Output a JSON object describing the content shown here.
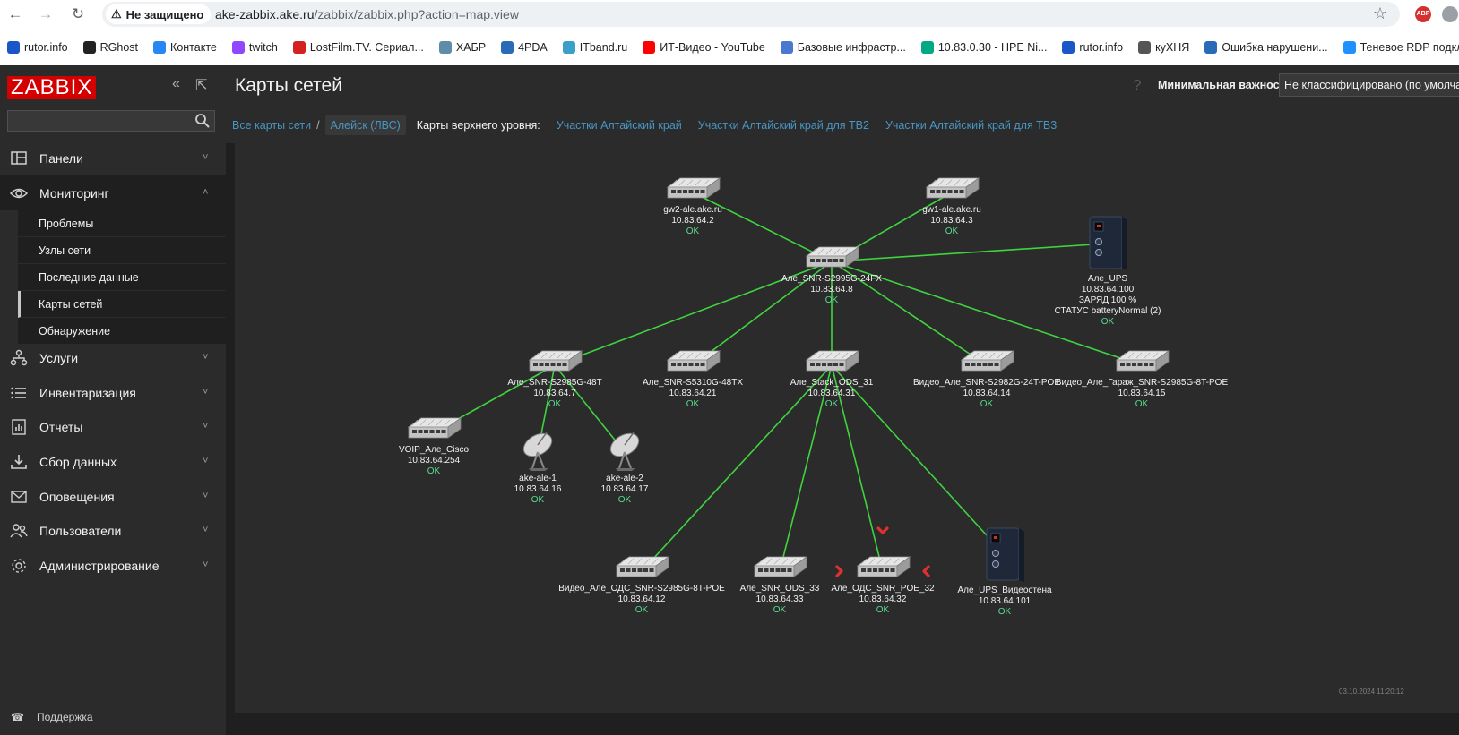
{
  "browser": {
    "security_label": "Не защищено",
    "url_host": "ake-zabbix.ake.ru",
    "url_path": "/zabbix/zabbix.php?action=map.view",
    "ext_label": "ABP"
  },
  "bookmarks": [
    {
      "label": "rutor.info",
      "icon": "rutor-icon",
      "color": "#1a56c8"
    },
    {
      "label": "RGhost",
      "icon": "rghost-icon",
      "color": "#222222"
    },
    {
      "label": "Контакте",
      "icon": "vk-icon",
      "color": "#2787f5"
    },
    {
      "label": "twitch",
      "icon": "twitch-icon",
      "color": "#9146ff"
    },
    {
      "label": "LostFilm.TV. Сериал...",
      "icon": "lostfilm-icon",
      "color": "#d42020"
    },
    {
      "label": "ХАБР",
      "icon": "habr-icon",
      "color": "#5f8da8"
    },
    {
      "label": "4PDA",
      "icon": "4pda-icon",
      "color": "#2a6bb8"
    },
    {
      "label": "ITband.ru",
      "icon": "itband-icon",
      "color": "#3aa0c8"
    },
    {
      "label": "ИТ-Видео - YouTube",
      "icon": "youtube-icon",
      "color": "#ff0000"
    },
    {
      "label": "Базовые инфрастр...",
      "icon": "globe-icon",
      "color": "#4a78d0"
    },
    {
      "label": "10.83.0.30 - HPE Ni...",
      "icon": "hpe-icon",
      "color": "#01a982"
    },
    {
      "label": "rutor.info",
      "icon": "rutor-icon",
      "color": "#1a56c8"
    },
    {
      "label": "куХНЯ",
      "icon": "globe-icon",
      "color": "#555555"
    },
    {
      "label": "Ошибка нарушени...",
      "icon": "doc-icon",
      "color": "#2a6bb8"
    },
    {
      "label": "Теневое RDP подкл...",
      "icon": "windows-icon",
      "color": "#1e90ff"
    }
  ],
  "sidebar": {
    "logo": "ZABBIX",
    "menu": [
      {
        "label": "Панели",
        "icon": "dashboard-icon"
      },
      {
        "label": "Мониторинг",
        "icon": "eye-icon",
        "open": true
      },
      {
        "label": "Услуги",
        "icon": "services-icon"
      },
      {
        "label": "Инвентаризация",
        "icon": "list-icon"
      },
      {
        "label": "Отчеты",
        "icon": "reports-icon"
      },
      {
        "label": "Сбор данных",
        "icon": "download-icon"
      },
      {
        "label": "Оповещения",
        "icon": "envelope-icon"
      },
      {
        "label": "Пользователи",
        "icon": "users-icon"
      },
      {
        "label": "Администрирование",
        "icon": "gear-icon"
      }
    ],
    "submenu": [
      {
        "label": "Проблемы"
      },
      {
        "label": "Узлы сети"
      },
      {
        "label": "Последние данные"
      },
      {
        "label": "Карты сетей",
        "active": true
      },
      {
        "label": "Обнаружение"
      }
    ],
    "support": "Поддержка"
  },
  "header": {
    "title": "Карты сетей",
    "severity_label": "Минимальная важность",
    "severity_value": "Не классифицировано (по умолчан"
  },
  "breadcrumb": {
    "all_maps": "Все карты сети",
    "current": "Алейск (ЛВС)",
    "upper_label": "Карты верхнего уровня:",
    "upper_links": [
      "Участки Алтайский край",
      "Участки Алтайский край для ТВ2",
      "Участки Алтайский край для ТВ3"
    ]
  },
  "map": {
    "timestamp": "03.10.2024 11:20:12",
    "colors": {
      "link": "#3fd43f",
      "ok": "#59db8f",
      "problem": "#e03030"
    },
    "nodes": [
      {
        "id": "gw2",
        "type": "switch",
        "lines": [
          "gw2-ale.ake.ru",
          "10.83.64.2"
        ],
        "status": "OK"
      },
      {
        "id": "gw1",
        "type": "switch",
        "lines": [
          "gw1-ale.ake.ru",
          "10.83.64.3"
        ],
        "status": "OK"
      },
      {
        "id": "core",
        "type": "switch",
        "lines": [
          "Але_SNR-S2995G-24FX",
          "10.83.64.8"
        ],
        "status": "OK"
      },
      {
        "id": "ups",
        "type": "ups",
        "lines": [
          "Але_UPS",
          "10.83.64.100",
          "ЗАРЯД 100 %",
          "СТАТУС batteryNormal (2)"
        ],
        "status": "OK"
      },
      {
        "id": "sw7",
        "type": "switch",
        "lines": [
          "Але_SNR-S2985G-48T",
          "10.83.64.7"
        ],
        "status": "OK"
      },
      {
        "id": "sw21",
        "type": "switch",
        "lines": [
          "Але_SNR-S5310G-48TX",
          "10.83.64.21"
        ],
        "status": "OK"
      },
      {
        "id": "stack",
        "type": "switch",
        "lines": [
          "Але_Stack_ODS_31",
          "10.83.64.31"
        ],
        "status": "OK"
      },
      {
        "id": "vid14",
        "type": "switch",
        "lines": [
          "Видео_Але_SNR-S2982G-24T-POE",
          "10.83.64.14"
        ],
        "status": "OK"
      },
      {
        "id": "vid15",
        "type": "switch",
        "lines": [
          "Видео_Але_Гараж_SNR-S2985G-8T-POE",
          "10.83.64.15"
        ],
        "status": "OK"
      },
      {
        "id": "voip",
        "type": "switch",
        "lines": [
          "VOIP_Але_Cisco",
          "10.83.64.254"
        ],
        "status": "OK"
      },
      {
        "id": "ant1",
        "type": "antenna",
        "lines": [
          "ake-ale-1",
          "10.83.64.16"
        ],
        "status": "OK"
      },
      {
        "id": "ant2",
        "type": "antenna",
        "lines": [
          "ake-ale-2",
          "10.83.64.17"
        ],
        "status": "OK"
      },
      {
        "id": "vid12",
        "type": "switch",
        "lines": [
          "Видео_Але_ОДС_SNR-S2985G-8T-POE",
          "10.83.64.12"
        ],
        "status": "OK"
      },
      {
        "id": "ods33",
        "type": "switch",
        "lines": [
          "Але_SNR_ODS_33",
          "10.83.64.33"
        ],
        "status": "OK"
      },
      {
        "id": "poe32",
        "type": "switch",
        "lines": [
          "Але_ОДС_SNR_POE_32",
          "10.83.64.32"
        ],
        "status": "OK",
        "selected": true
      },
      {
        "id": "ups101",
        "type": "ups",
        "lines": [
          "Але_UPS_Видеостена",
          "10.83.64.101"
        ],
        "status": "OK"
      }
    ],
    "links": [
      [
        "gw2",
        "core"
      ],
      [
        "gw1",
        "core"
      ],
      [
        "core",
        "ups"
      ],
      [
        "core",
        "sw7"
      ],
      [
        "core",
        "sw21"
      ],
      [
        "core",
        "stack"
      ],
      [
        "core",
        "vid14"
      ],
      [
        "core",
        "vid15"
      ],
      [
        "sw7",
        "voip"
      ],
      [
        "sw7",
        "ant1"
      ],
      [
        "sw7",
        "ant2"
      ],
      [
        "stack",
        "vid12"
      ],
      [
        "stack",
        "ods33"
      ],
      [
        "stack",
        "poe32"
      ],
      [
        "stack",
        "ups101"
      ]
    ]
  }
}
